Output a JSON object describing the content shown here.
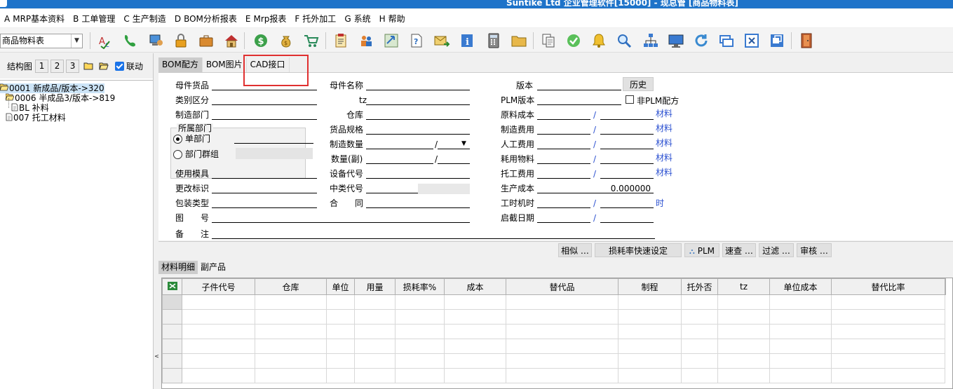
{
  "title": {
    "text": "Suntike Ltd 企业管理软件[15000] - 现总管 [商品物料表]"
  },
  "menu": [
    {
      "key": "A",
      "label": "MRP基本资料"
    },
    {
      "key": "B",
      "label": "工单管理"
    },
    {
      "key": "C",
      "label": "生产制造"
    },
    {
      "key": "D",
      "label": "BOM分析报表"
    },
    {
      "key": "E",
      "label": "Mrp报表"
    },
    {
      "key": "F",
      "label": "托外加工"
    },
    {
      "key": "G",
      "label": "系统"
    },
    {
      "key": "H",
      "label": "帮助"
    }
  ],
  "toolbar": {
    "combo_value": "商品物料表"
  },
  "left": {
    "label": "结构图",
    "levels": [
      "1",
      "2",
      "3"
    ],
    "link_label": "联动",
    "tree": [
      {
        "text": "0001 新成品/版本->320",
        "icon": "open-folder-icon"
      },
      {
        "text": "0006 半成品3/版本->819",
        "icon": "open-folder-icon"
      },
      {
        "text": "BL 补料",
        "icon": "document-icon"
      },
      {
        "text": "007 托工材料",
        "icon": "document-icon"
      }
    ]
  },
  "tabs": [
    "BOM配方",
    "BOM图片",
    "CAD接口"
  ],
  "form": {
    "col1": [
      "母件货品",
      "类别区分",
      "制造部门",
      "使用模具",
      "更改标识",
      "包装类型",
      "图　　号",
      "备　　注"
    ],
    "group_title": "所属部门",
    "radio1": "单部门",
    "radio2": "部门群组",
    "col2": [
      "母件名称",
      "tz",
      "仓库",
      "货品规格",
      "制造数量",
      "数量(副)",
      "设备代号",
      "中类代号",
      "合　　同"
    ],
    "col3": [
      "版本",
      "PLM版本",
      "原料成本",
      "制造费用",
      "人工费用",
      "耗用物料",
      "托工费用",
      "生产成本",
      "工时机时",
      "启截日期"
    ],
    "history_btn": "历史",
    "non_plm": "非PLM配方",
    "material": "材料",
    "hour": "时",
    "slash": "/",
    "production_cost": "0.000000"
  },
  "buttons": [
    "相似 …",
    "损耗率快速设定",
    "PLM",
    "速查 …",
    "过滤 …",
    "审核 …"
  ],
  "subtabs": [
    "材料明细",
    "副产品"
  ],
  "grid": {
    "columns": [
      "子件代号",
      "仓库",
      "单位",
      "用量",
      "损耗率%",
      "成本",
      "替代品",
      "制程",
      "托外否",
      "tz",
      "单位成本",
      "替代比率"
    ]
  },
  "colors": {
    "titlebar": "#1e73c9",
    "highlight": "#e03030",
    "link": "#2a4fd0"
  }
}
